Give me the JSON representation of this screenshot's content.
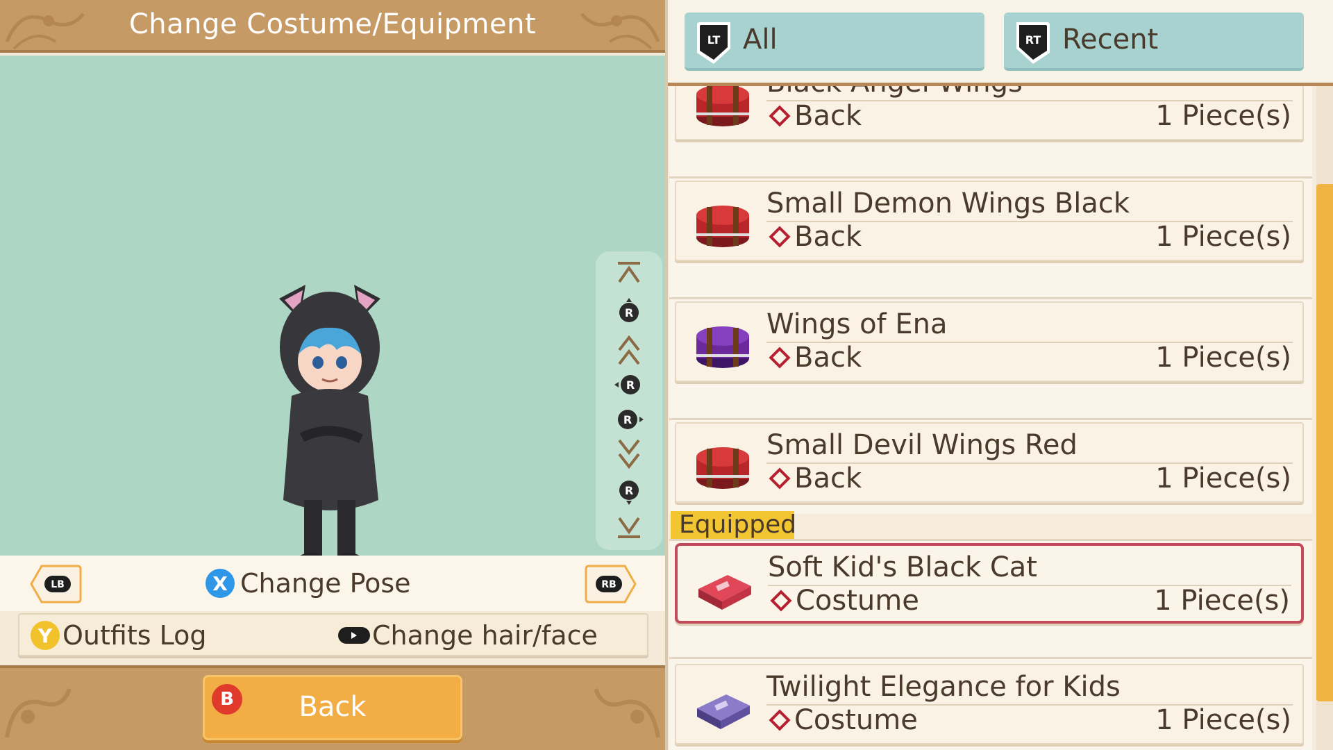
{
  "header": {
    "title": "Change Costume/Equipment"
  },
  "preview": {
    "camera_controls": [
      "top-icon",
      "r-stick-up-icon",
      "double-up-icon",
      "r-stick-left-icon",
      "r-stick-right-icon",
      "double-down-icon",
      "r-stick-down-icon",
      "bottom-icon"
    ]
  },
  "pose_row": {
    "lb": "LB",
    "rb": "RB",
    "x_button": "X",
    "change_pose": "Change Pose"
  },
  "outfit_row": {
    "y_button": "Y",
    "outfits_log": "Outfits Log",
    "change_hair": "Change hair/face"
  },
  "back_button": {
    "b_button": "B",
    "label": "Back"
  },
  "tabs": [
    {
      "badge": "LT",
      "label": "All"
    },
    {
      "badge": "RT",
      "label": "Recent"
    }
  ],
  "list": {
    "equipped_tag": "Equipped",
    "items": [
      {
        "name": "Black Angel Wings",
        "category": "Back",
        "qty": "1 Piece(s)",
        "icon": "red-box-icon",
        "color": "#b8262a"
      },
      {
        "name": "Small Demon Wings Black",
        "category": "Back",
        "qty": "1 Piece(s)",
        "icon": "red-box-icon",
        "color": "#b8262a"
      },
      {
        "name": "Wings of Ena",
        "category": "Back",
        "qty": "1 Piece(s)",
        "icon": "purple-box-icon",
        "color": "#6a2a9c"
      },
      {
        "name": "Small Devil Wings Red",
        "category": "Back",
        "qty": "1 Piece(s)",
        "icon": "red-box-icon",
        "color": "#b8262a"
      },
      {
        "name": "Soft Kid's Black Cat",
        "category": "Costume",
        "qty": "1 Piece(s)",
        "icon": "costume-case-red-icon",
        "color": "#d84050"
      },
      {
        "name": "Twilight Elegance for Kids",
        "category": "Costume",
        "qty": "1 Piece(s)",
        "icon": "costume-case-purple-icon",
        "color": "#6d5aa8"
      }
    ]
  },
  "colors": {
    "accent": "#c69a64",
    "preview_bg": "#aed6c4",
    "equipped_border": "#c14a5c",
    "scroll_thumb": "#f0b445"
  }
}
